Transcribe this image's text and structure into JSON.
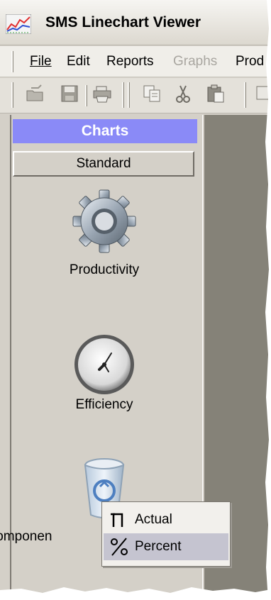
{
  "window": {
    "title": "SMS Linechart Viewer"
  },
  "menubar": {
    "items": [
      {
        "label": "File",
        "enabled": true
      },
      {
        "label": "Edit",
        "enabled": true
      },
      {
        "label": "Reports",
        "enabled": true
      },
      {
        "label": "Graphs",
        "enabled": false
      },
      {
        "label": "Prod",
        "enabled": true
      }
    ]
  },
  "toolbar": {
    "buttons": [
      {
        "icon": "open-folder-icon"
      },
      {
        "icon": "save-icon"
      },
      {
        "icon": "print-icon"
      },
      {
        "icon": "copy-icon"
      },
      {
        "icon": "cut-icon"
      },
      {
        "icon": "paste-icon"
      }
    ]
  },
  "sidebar": {
    "header": "Charts",
    "group_button": "Standard",
    "items": [
      {
        "label": "Productivity",
        "icon": "gear-icon"
      },
      {
        "label": "Efficiency",
        "icon": "clock-icon"
      },
      {
        "label": "Componen",
        "icon": "recycle-bin-icon"
      }
    ]
  },
  "popup_menu": {
    "items": [
      {
        "label": "Actual",
        "icon": "actual-icon",
        "selected": false
      },
      {
        "label": "Percent",
        "icon": "percent-icon",
        "selected": true
      }
    ]
  },
  "colors": {
    "charts_header": "#8a8af7",
    "panel_bg": "#d4d0c8",
    "dark_area": "#858278",
    "popup_selected": "#c5c4d0"
  }
}
